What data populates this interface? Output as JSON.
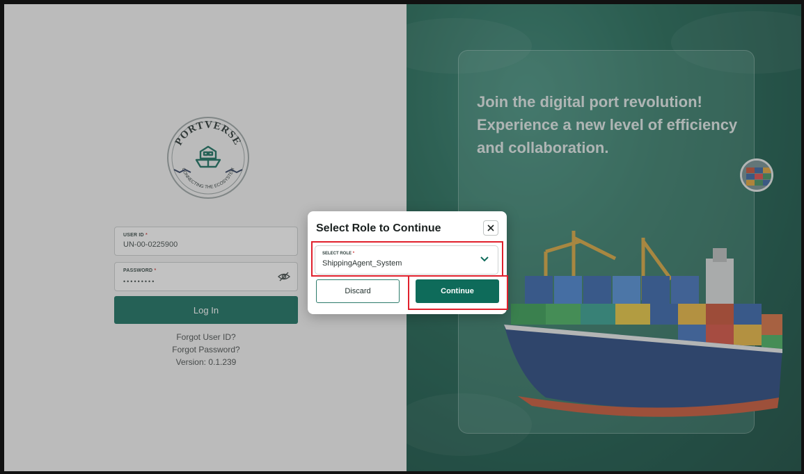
{
  "brand": {
    "logo_text": "PORTVERSE",
    "tagline": "CONNECTING THE ECOSYSTEM"
  },
  "login": {
    "userid_label": "USER ID",
    "userid_value": "UN-00-0225900",
    "password_label": "PASSWORD",
    "password_value": "•••••••••",
    "required_mark": "*",
    "login_button": "Log In",
    "forgot_userid": "Forgot User ID?",
    "forgot_password": "Forgot Password?",
    "version": "Version: 0.1.239"
  },
  "hero": {
    "text": "Join the digital port revolution! Experience a new level of efficiency and collaboration."
  },
  "modal": {
    "title": "Select Role to Continue",
    "select_label": "SELECT ROLE",
    "required_mark": "*",
    "selected_role": "ShippingAgent_System",
    "discard_label": "Discard",
    "continue_label": "Continue"
  },
  "colors": {
    "primary": "#0e6b5a",
    "highlight": "#e0202c",
    "hero_bg": "#17634f"
  }
}
